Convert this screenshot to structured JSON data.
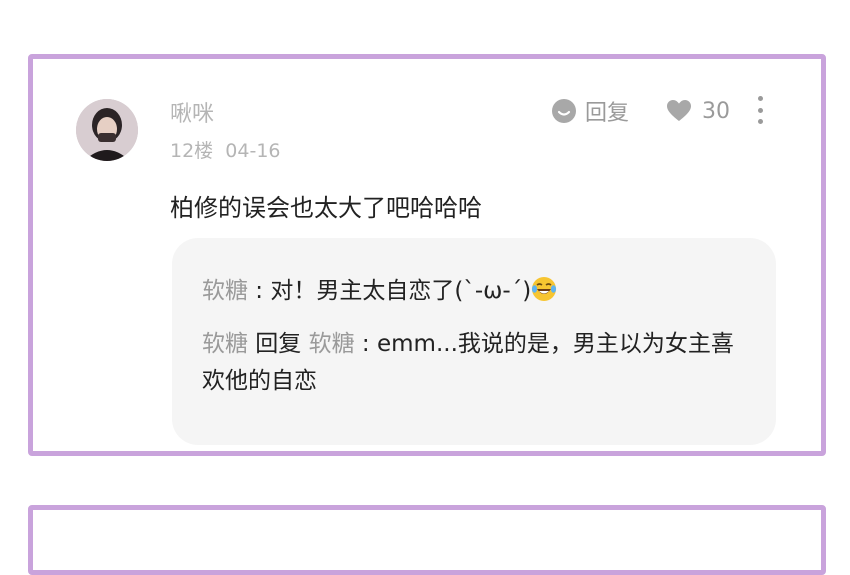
{
  "comment": {
    "username": "啾咪",
    "floor": "12楼",
    "date": "04-16",
    "text": "柏修的误会也太大了吧哈哈哈",
    "reply_label": "回复",
    "like_count": "30"
  },
  "replies": [
    {
      "author": "软糖",
      "separator": " : ",
      "text": "对！男主太自恋了(`-ω-´)",
      "emoji": "laughing-tears-emoji"
    },
    {
      "author": "软糖",
      "reply_word": " 回复 ",
      "target": "软糖",
      "separator": " : ",
      "text": "emm...我说的是，男主以为女主喜欢他的自恋"
    }
  ],
  "colors": {
    "card_border": "#c9a3dc",
    "reply_bg": "#f5f5f5",
    "muted": "#b5b5b5"
  }
}
